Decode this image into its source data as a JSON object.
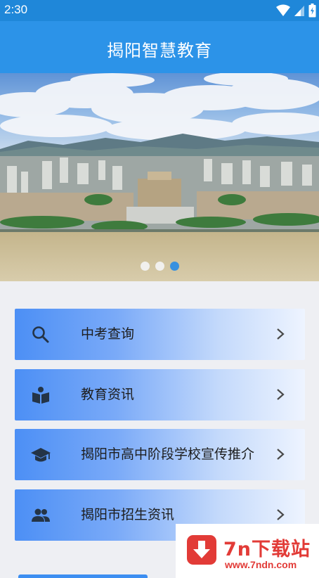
{
  "status_bar": {
    "time": "2:30",
    "icons": [
      "wifi-icon",
      "signal-icon",
      "battery-icon"
    ]
  },
  "app_bar": {
    "title": "揭阳智慧教育"
  },
  "banner": {
    "image": "city-aerial-photo",
    "page_count": 3,
    "active_index": 2
  },
  "menu": [
    {
      "label": "中考查询",
      "icon": "search-icon"
    },
    {
      "label": "教育资讯",
      "icon": "open-book-icon"
    },
    {
      "label": "揭阳市高中阶段学校宣传推介",
      "icon": "graduation-cap-icon"
    },
    {
      "label": "揭阳市招生资讯",
      "icon": "people-icon"
    }
  ],
  "watermark": {
    "brand": "7n下载站",
    "url": "www.7ndn.com"
  },
  "colors": {
    "app_bar": "#2c93e8",
    "status_bar": "#1f87d9",
    "menu_gradient_start": "#4c8ff5",
    "active_dot": "#2f8ee3",
    "watermark": "#e23b37"
  }
}
